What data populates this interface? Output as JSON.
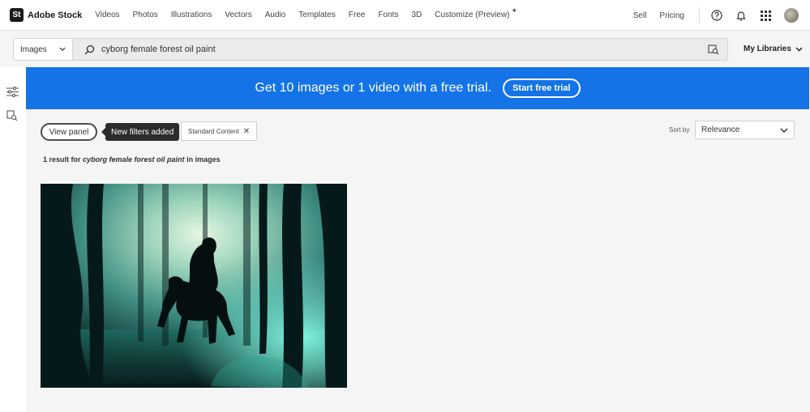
{
  "brand": {
    "mark": "St",
    "name": "Adobe Stock"
  },
  "nav": {
    "links": [
      "Videos",
      "Photos",
      "Illustrations",
      "Vectors",
      "Audio",
      "Templates",
      "Free",
      "Fonts",
      "3D",
      "Customize (Preview)"
    ],
    "sell": "Sell",
    "pricing": "Pricing"
  },
  "search": {
    "type": "Images",
    "query": "cyborg female forest oil paint"
  },
  "my_libraries": "My Libraries",
  "banner": {
    "text": "Get 10 images or 1 video with a free trial.",
    "button": "Start free trial",
    "color": "#1473e6"
  },
  "filters": {
    "view_panel": "View panel",
    "tooltip": "New filters added",
    "chip": "Standard Content"
  },
  "sort": {
    "label": "Sort by",
    "value": "Relevance"
  },
  "results": {
    "prefix": "1 result for",
    "query": "cyborg female forest oil paint",
    "suffix": "in images"
  }
}
